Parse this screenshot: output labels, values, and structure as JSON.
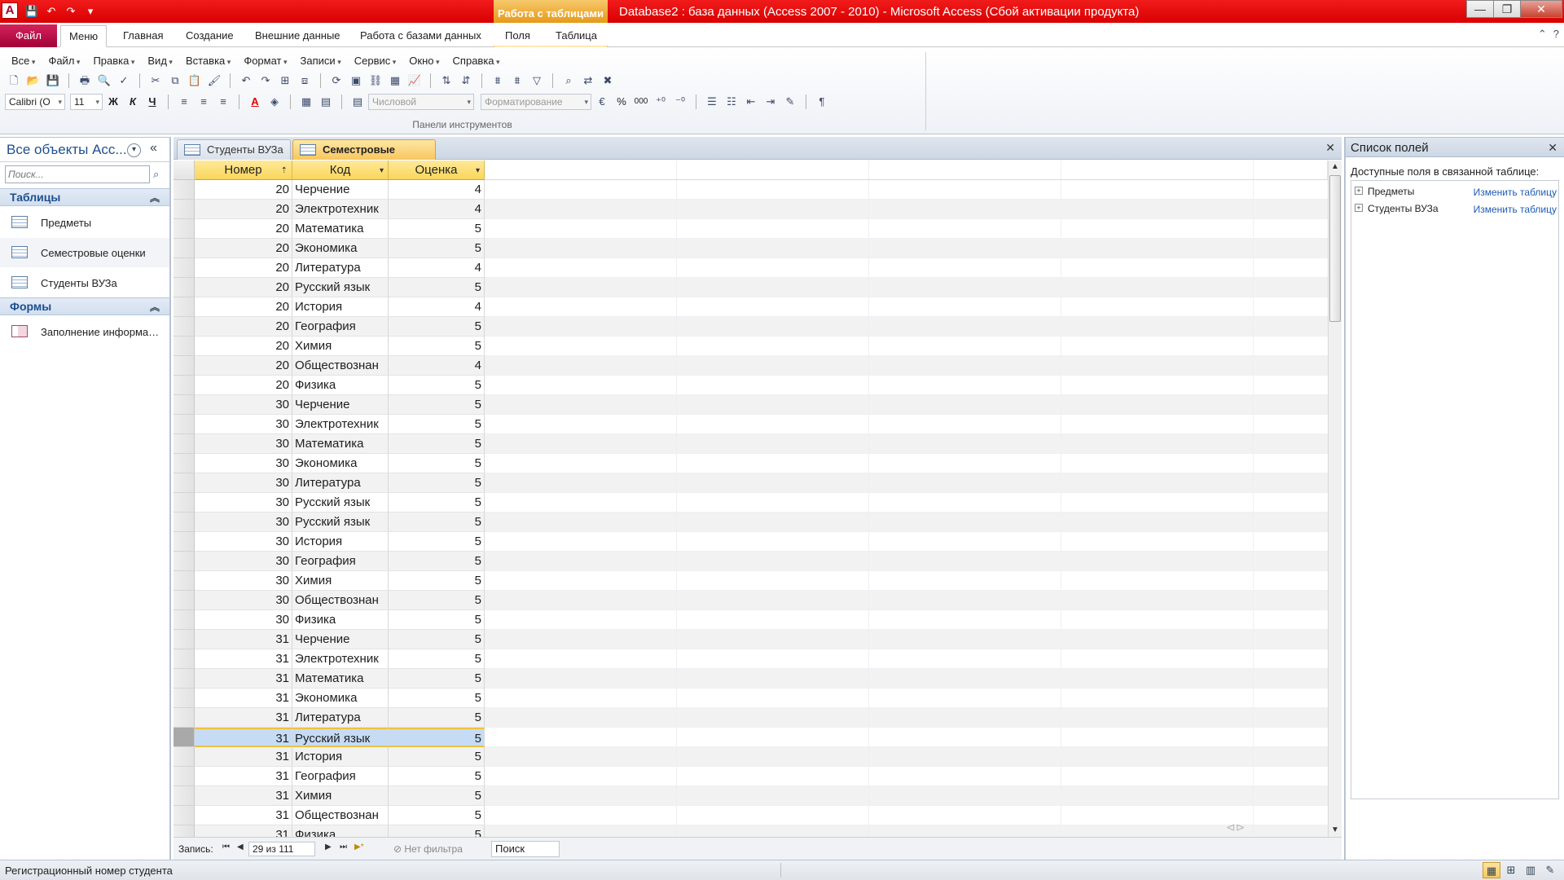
{
  "window": {
    "logo_letter": "A",
    "context_tab_group": "Работа с таблицами",
    "title": "Database2 : база данных (Access 2007 - 2010)  -  Microsoft Access (Сбой активации продукта)",
    "qat": {
      "save": "💾",
      "undo": "↶",
      "redo": "↷",
      "customize": "▾"
    },
    "controls": {
      "minimize": "—",
      "restore": "❐",
      "close": "✕"
    }
  },
  "ribbon_tabs": {
    "file": "Файл",
    "tabs": [
      "Меню",
      "Главная",
      "Создание",
      "Внешние данные",
      "Работа с базами данных"
    ],
    "context_tabs": [
      "Поля",
      "Таблица"
    ],
    "help_icon": "?",
    "minimize_icon": "⌃"
  },
  "menubar": {
    "items": [
      "Все",
      "Файл",
      "Правка",
      "Вид",
      "Вставка",
      "Формат",
      "Записи",
      "Сервис",
      "Окно",
      "Справка"
    ]
  },
  "toolbar": {
    "font_name": "Calibri (О",
    "font_size": "11",
    "bold": "Ж",
    "italic": "К",
    "underline": "Ч",
    "number_format": "Числовой",
    "conditional_format": "Форматирование",
    "percent": "%",
    "thousands": "000",
    "group_label": "Панели инструментов"
  },
  "nav_pane": {
    "title": "Все объекты Acc...",
    "search_placeholder": "Поиск...",
    "groups": [
      {
        "label": "Таблицы",
        "items": [
          "Предметы",
          "Семестровые оценки",
          "Студенты ВУЗа"
        ]
      },
      {
        "label": "Формы",
        "items": [
          "Заполнение информац..."
        ]
      }
    ],
    "selected_item": "Семестровые оценки"
  },
  "document": {
    "tabs": [
      "Студенты ВУЗа",
      "Семестровые оценки"
    ],
    "active_tab": "Семестровые оценки",
    "close_icon": "✕"
  },
  "datasheet": {
    "columns": [
      "Номер",
      "Код",
      "Оценка"
    ],
    "rows": [
      [
        "20",
        "Черчение",
        "4"
      ],
      [
        "20",
        "Электротехник",
        "4"
      ],
      [
        "20",
        "Математика",
        "5"
      ],
      [
        "20",
        "Экономика",
        "5"
      ],
      [
        "20",
        "Литература",
        "4"
      ],
      [
        "20",
        "Русский язык",
        "5"
      ],
      [
        "20",
        "История",
        "4"
      ],
      [
        "20",
        "География",
        "5"
      ],
      [
        "20",
        "Химия",
        "5"
      ],
      [
        "20",
        "Обществознан",
        "4"
      ],
      [
        "20",
        "Физика",
        "5"
      ],
      [
        "30",
        "Черчение",
        "5"
      ],
      [
        "30",
        "Электротехник",
        "5"
      ],
      [
        "30",
        "Математика",
        "5"
      ],
      [
        "30",
        "Экономика",
        "5"
      ],
      [
        "30",
        "Литература",
        "5"
      ],
      [
        "30",
        "Русский язык",
        "5"
      ],
      [
        "30",
        "Русский язык",
        "5"
      ],
      [
        "30",
        "История",
        "5"
      ],
      [
        "30",
        "География",
        "5"
      ],
      [
        "30",
        "Химия",
        "5"
      ],
      [
        "30",
        "Обществознан",
        "5"
      ],
      [
        "30",
        "Физика",
        "5"
      ],
      [
        "31",
        "Черчение",
        "5"
      ],
      [
        "31",
        "Электротехник",
        "5"
      ],
      [
        "31",
        "Математика",
        "5"
      ],
      [
        "31",
        "Экономика",
        "5"
      ],
      [
        "31",
        "Литература",
        "5"
      ],
      [
        "31",
        "Русский язык",
        "5"
      ],
      [
        "31",
        "История",
        "5"
      ],
      [
        "31",
        "География",
        "5"
      ],
      [
        "31",
        "Химия",
        "5"
      ],
      [
        "31",
        "Обществознан",
        "5"
      ],
      [
        "31",
        "Физика",
        "5"
      ]
    ],
    "current_row_index": 28
  },
  "record_nav": {
    "label": "Запись:",
    "first": "⏮",
    "prev": "◀",
    "counter": "29 из 111",
    "next": "▶",
    "last": "⏭",
    "new": "▶*",
    "filter": "Нет фильтра",
    "search": "Поиск"
  },
  "field_list": {
    "title": "Список полей",
    "caption": "Доступные поля в связанной таблице:",
    "tables": [
      {
        "name": "Предметы",
        "action": "Изменить таблицу"
      },
      {
        "name": "Студенты ВУЗа",
        "action": "Изменить таблицу"
      }
    ],
    "expand_icon": "+",
    "close_icon": "✕"
  },
  "statusbar": {
    "text": "Регистрационный номер студента"
  },
  "colors": {
    "title_red": "#e00000",
    "file_tab": "#b8144a",
    "header_yellow": "#fbdc6a",
    "selection_blue": "#c6dcf5",
    "link_blue": "#1e5bb4"
  }
}
